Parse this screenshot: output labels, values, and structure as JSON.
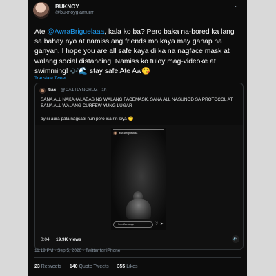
{
  "tweet": {
    "display_name": "BUKNOY",
    "handle": "@buknoyglamurrr",
    "text_before_mention": "Ate ",
    "mention": "@AwraBriguelaaa",
    "text_after_mention": ", kala ko ba? Pero baka na-bored ka lang sa bahay nyo at namiss ang friends mo kaya may ganap na ganyan. I hope you are all safe kaya di ka na nagface mask at walang social distancing. Namiss ko tuloy mag-videoke at swimming! 🎶🌊 stay safe Ate Aw😘",
    "translate_label": "Translate Tweet",
    "timestamp": "11:19 PM · Sep 5, 2020 · Twitter for iPhone",
    "retweets_count": "23",
    "retweets_label": "Retweets",
    "quote_count": "140",
    "quote_label": "Quote Tweets",
    "likes_count": "355",
    "likes_label": "Likes"
  },
  "quoted": {
    "display_name": "tiac",
    "meta": "@CA1TLYNCRUZ · 1h",
    "text": "SANA ALL NAKAKALABAS NG WALANG FACEMASK, SANA ALL NASUNOD SA PROTOCOL AT SANA ALL WALANG CURFEW YUNG LUGAR",
    "text2": "ay si aura pala nagsabi nun pero isa rin siya 🙃",
    "video": {
      "story_user": "awrabriguelaaa",
      "send_message": "Send Message",
      "duration": "0:04",
      "views": "19.9K views"
    }
  }
}
